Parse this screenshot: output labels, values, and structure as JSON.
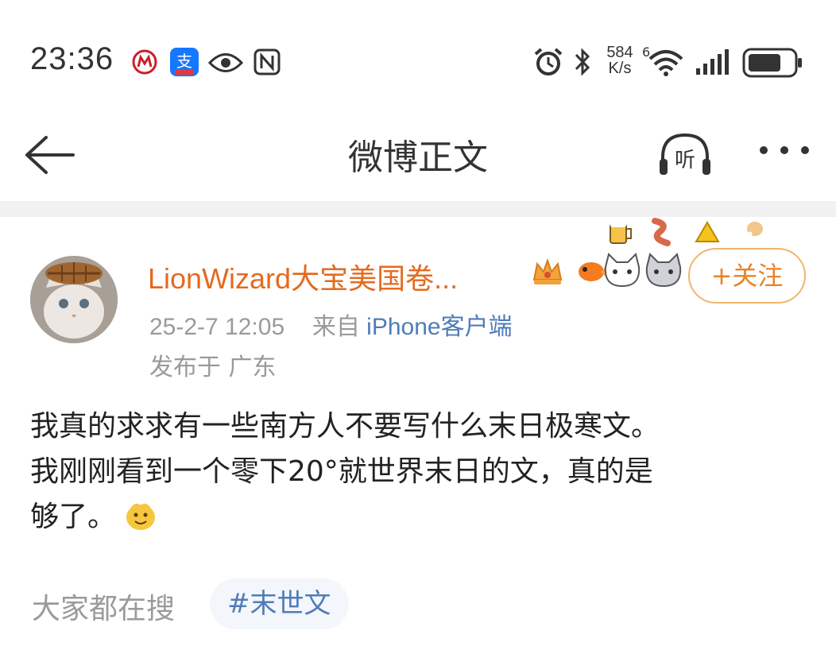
{
  "status_bar": {
    "time": "23:36",
    "net_speed_value": "584",
    "net_speed_unit": "K/s",
    "signal_label": "6"
  },
  "nav": {
    "title": "微博正文",
    "listen_label": "听"
  },
  "post": {
    "username": "LionWizard大宝美国卷...",
    "date": "25-2-7 12:05",
    "from_prefix": "来自 ",
    "source": "iPhone客户端",
    "location": "发布于 广东",
    "follow_label": "+关注",
    "text_lines": [
      "我真的求求有一些南方人不要写什么末日极寒文。",
      "我刚刚看到一个零下20°就世界末日的文，真的是",
      "够了。"
    ]
  },
  "footer": {
    "search_label": "大家都在搜",
    "tag": "#末世文"
  },
  "colors": {
    "username": "#e56a1f",
    "source_link": "#4f7cb8",
    "meta_gray": "#9a9a9a",
    "follow_border": "#f0b66d"
  }
}
